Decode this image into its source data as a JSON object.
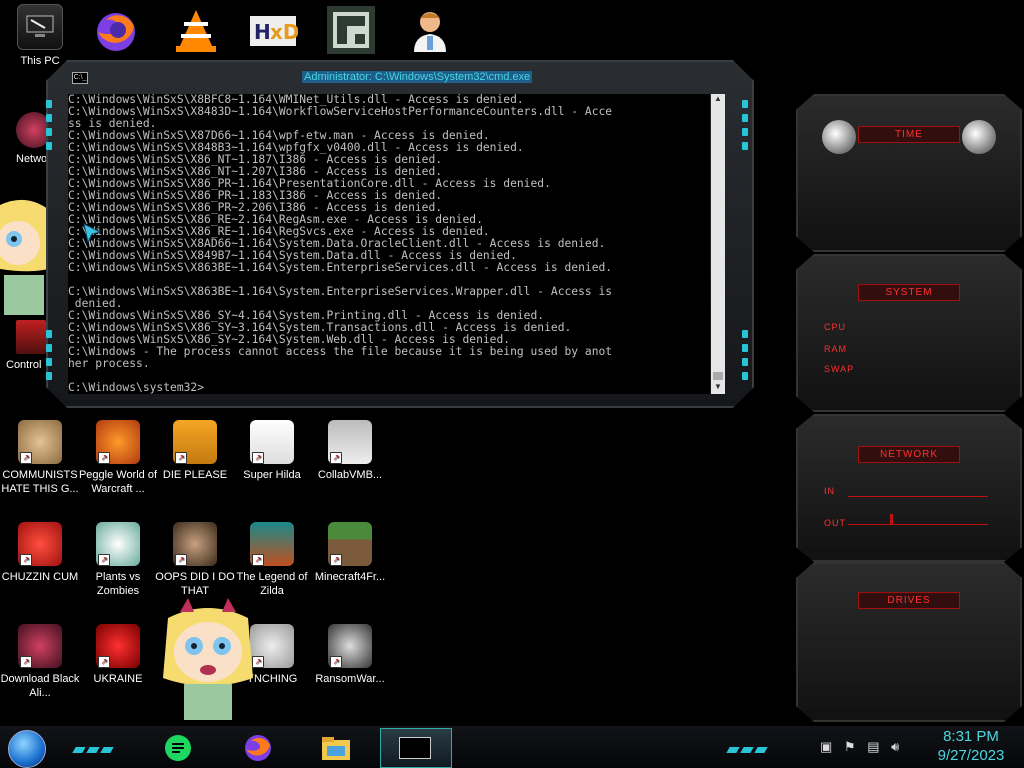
{
  "desktop": {
    "top_row": [
      {
        "label": "This PC",
        "icon": "computer-icon"
      },
      {
        "label": "",
        "icon": "firefox-icon"
      },
      {
        "label": "",
        "icon": "vlc-icon"
      },
      {
        "label": "",
        "icon": "hxd-icon"
      },
      {
        "label": "",
        "icon": "app-icon"
      },
      {
        "label": "",
        "icon": "doctor-icon"
      }
    ],
    "left_col": [
      {
        "label": "Netwo",
        "icon": "network-icon"
      },
      {
        "label": "Control",
        "icon": "control-panel-icon"
      }
    ],
    "icons": [
      {
        "label": "COMMUNISTS HATE THIS G...",
        "icon": "money-bag-icon"
      },
      {
        "label": "Peggle World of Warcraft ...",
        "icon": "peggle-icon"
      },
      {
        "label": "DIE PLEASE",
        "icon": "die-icon"
      },
      {
        "label": "Super Hilda",
        "icon": "super-hilda-icon"
      },
      {
        "label": "CollabVMB...",
        "icon": "collabvm-icon"
      },
      {
        "label": "CHUZZIN CUM",
        "icon": "chuzzle-icon"
      },
      {
        "label": "Plants vs Zombies",
        "icon": "pvz-icon"
      },
      {
        "label": "OOPS DID I DO THAT",
        "icon": "portrait-icon"
      },
      {
        "label": "The Legend of Zilda",
        "icon": "zelda-icon"
      },
      {
        "label": "Minecraft4Fr...",
        "icon": "minecraft-icon"
      },
      {
        "label": "Download Black Ali...",
        "icon": "black-alien-icon"
      },
      {
        "label": "UKRAINE",
        "icon": "radiation-icon"
      },
      {
        "label": "YNCHING",
        "icon": "lynching-icon"
      },
      {
        "label": "RansomWar...",
        "icon": "skull-icon"
      }
    ]
  },
  "cmd": {
    "title": "Administrator: C:\\Windows\\System32\\cmd.exe",
    "icon_text": "C:\\_",
    "lines": [
      "C:\\Windows\\WinSxS\\X8BFC8~1.164\\WMINet_Utils.dll - Access is denied.",
      "C:\\Windows\\WinSxS\\X8483D~1.164\\WorkflowServiceHostPerformanceCounters.dll - Acce",
      "ss is denied.",
      "C:\\Windows\\WinSxS\\X87D66~1.164\\wpf-etw.man - Access is denied.",
      "C:\\Windows\\WinSxS\\X848B3~1.164\\wpfgfx_v0400.dll - Access is denied.",
      "C:\\Windows\\WinSxS\\X86_NT~1.187\\I386 - Access is denied.",
      "C:\\Windows\\WinSxS\\X86_NT~1.207\\I386 - Access is denied.",
      "C:\\Windows\\WinSxS\\X86_PR~1.164\\PresentationCore.dll - Access is denied.",
      "C:\\Windows\\WinSxS\\X86_PR~1.183\\I386 - Access is denied.",
      "C:\\Windows\\WinSxS\\X86_PR~2.206\\I386 - Access is denied.",
      "C:\\Windows\\WinSxS\\X86_RE~2.164\\RegAsm.exe - Access is denied.",
      "C:\\Windows\\WinSxS\\X86_RE~1.164\\RegSvcs.exe - Access is denied.",
      "C:\\Windows\\WinSxS\\X8AD66~1.164\\System.Data.OracleClient.dll - Access is denied.",
      "C:\\Windows\\WinSxS\\X849B7~1.164\\System.Data.dll - Access is denied.",
      "C:\\Windows\\WinSxS\\X863BE~1.164\\System.EnterpriseServices.dll - Access is denied.",
      "",
      "C:\\Windows\\WinSxS\\X863BE~1.164\\System.EnterpriseServices.Wrapper.dll - Access is",
      " denied.",
      "C:\\Windows\\WinSxS\\X86_SY~4.164\\System.Printing.dll - Access is denied.",
      "C:\\Windows\\WinSxS\\X86_SY~3.164\\System.Transactions.dll - Access is denied.",
      "C:\\Windows\\WinSxS\\X86_SY~2.164\\System.Web.dll - Access is denied.",
      "C:\\Windows - The process cannot access the file because it is being used by anot",
      "her process.",
      "",
      "C:\\Windows\\system32>"
    ]
  },
  "widgets": {
    "time": {
      "title": "TIME"
    },
    "system": {
      "title": "SYSTEM",
      "cpu": "CPU",
      "ram": "RAM",
      "swap": "SWAP"
    },
    "network": {
      "title": "NETWORK",
      "in": "IN",
      "out": "OUT"
    },
    "drives": {
      "title": "DRIVES"
    }
  },
  "taskbar": {
    "apps": [
      "chat-icon",
      "firefox-icon",
      "file-explorer-icon",
      "cmd-icon"
    ],
    "tray": [
      "nvidia-icon",
      "flag-icon",
      "network-icon",
      "volume-icon"
    ],
    "time": "8:31 PM",
    "date": "9/27/2023"
  },
  "colors": {
    "accent_cyan": "#28c4d8",
    "accent_red": "#ff3030",
    "console_text": "#c0c0c0"
  }
}
